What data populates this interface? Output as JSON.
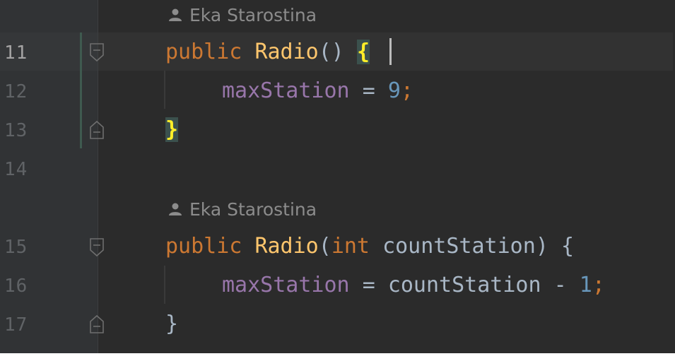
{
  "author_hints": [
    {
      "author": "Eka Starostina"
    },
    {
      "author": "Eka Starostina"
    }
  ],
  "lines": [
    {
      "number": "11"
    },
    {
      "number": "12"
    },
    {
      "number": "13"
    },
    {
      "number": "14"
    },
    {
      "number": "15"
    },
    {
      "number": "16"
    },
    {
      "number": "17"
    }
  ],
  "code": {
    "l11": {
      "kw": "public",
      "fn": "Radio",
      "parens": "()",
      "open_brace": "{"
    },
    "l12": {
      "field": "maxStation",
      "op": "=",
      "num": "9",
      "semi": ";"
    },
    "l13": {
      "close_brace": "}"
    },
    "l15": {
      "kw": "public",
      "fn": "Radio",
      "open_paren": "(",
      "type": "int",
      "param": "countStation",
      "close_paren": ")",
      "open_brace": "{"
    },
    "l16": {
      "field": "maxStation",
      "op": "=",
      "param": "countStation",
      "minus": "-",
      "num": "1",
      "semi": ";"
    },
    "l17": {
      "close_brace": "}"
    }
  },
  "icons": {
    "author": "person-icon",
    "fold_start": "fold-start-icon",
    "fold_end": "fold-end-icon"
  },
  "colors": {
    "background": "#2b2b2b",
    "keyword": "#cc7832",
    "method": "#ffc66d",
    "field": "#9876aa",
    "number": "#6897bb",
    "text": "#a9b7c6",
    "matched_brace": "#ffef28"
  }
}
